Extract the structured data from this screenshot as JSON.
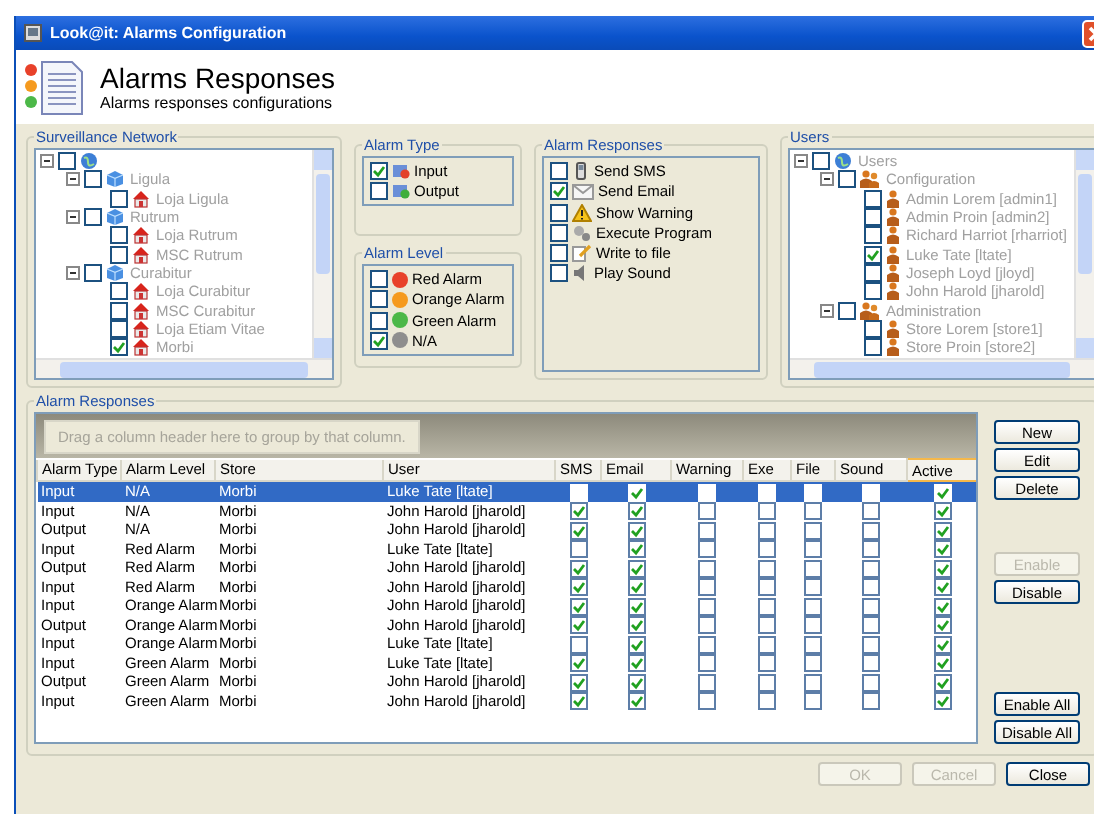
{
  "window": {
    "title": "Look@it: Alarms Configuration"
  },
  "header": {
    "title": "Alarms Responses",
    "subtitle": "Alarms responses configurations"
  },
  "surveillance_network": {
    "title": "Surveillance Network",
    "nodes": [
      {
        "kind": "globe",
        "checked": false,
        "expanded": true,
        "children": [
          {
            "label": "Ligula",
            "kind": "region",
            "checked": false,
            "expanded": true,
            "children": [
              {
                "label": "Loja Ligula",
                "kind": "store",
                "checked": false
              }
            ]
          },
          {
            "label": "Rutrum",
            "kind": "region",
            "checked": false,
            "expanded": true,
            "children": [
              {
                "label": "Loja Rutrum",
                "kind": "store",
                "checked": false
              },
              {
                "label": "MSC Rutrum",
                "kind": "store",
                "checked": false
              }
            ]
          },
          {
            "label": "Curabitur",
            "kind": "region",
            "checked": false,
            "expanded": true,
            "children": [
              {
                "label": "Loja Curabitur",
                "kind": "store",
                "checked": false
              },
              {
                "label": "MSC Curabitur",
                "kind": "store",
                "checked": false
              },
              {
                "label": "Loja Etiam Vitae",
                "kind": "store",
                "checked": false
              },
              {
                "label": "Morbi",
                "kind": "store",
                "checked": true
              }
            ]
          }
        ]
      }
    ]
  },
  "alarm_type": {
    "title": "Alarm Type",
    "items": [
      {
        "label": "Input",
        "checked": true,
        "kind": "input"
      },
      {
        "label": "Output",
        "checked": false,
        "kind": "output"
      }
    ]
  },
  "alarm_level": {
    "title": "Alarm Level",
    "items": [
      {
        "label": "Red Alarm",
        "checked": false,
        "color": "#e8412a"
      },
      {
        "label": "Orange Alarm",
        "checked": false,
        "color": "#f59a1e"
      },
      {
        "label": "Green Alarm",
        "checked": false,
        "color": "#4cb848"
      },
      {
        "label": "N/A",
        "checked": true,
        "color": "#8e8e8e"
      }
    ]
  },
  "alarm_responses_options": {
    "title": "Alarm Responses",
    "items": [
      {
        "label": "Send SMS",
        "checked": false,
        "kind": "sms"
      },
      {
        "label": "Send Email",
        "checked": true,
        "kind": "email"
      },
      {
        "label": "Show Warning",
        "checked": false,
        "kind": "warning"
      },
      {
        "label": "Execute Program",
        "checked": false,
        "kind": "program"
      },
      {
        "label": "Write to file",
        "checked": false,
        "kind": "file"
      },
      {
        "label": "Play Sound",
        "checked": false,
        "kind": "sound"
      }
    ]
  },
  "users": {
    "title": "Users",
    "nodes": [
      {
        "label": "Users",
        "kind": "globe",
        "checked": false,
        "expanded": true,
        "children": [
          {
            "label": "Configuration",
            "kind": "group",
            "checked": false,
            "expanded": true,
            "children": [
              {
                "label": "Admin Lorem [admin1]",
                "kind": "user",
                "checked": false
              },
              {
                "label": "Admin Proin [admin2]",
                "kind": "user",
                "checked": false
              },
              {
                "label": "Richard Harriot [rharriot]",
                "kind": "user",
                "checked": false
              },
              {
                "label": "Luke Tate [ltate]",
                "kind": "user",
                "checked": true
              },
              {
                "label": "Joseph Loyd [jloyd]",
                "kind": "user",
                "checked": false
              },
              {
                "label": "John Harold [jharold]",
                "kind": "user",
                "checked": false
              }
            ]
          },
          {
            "label": "Administration",
            "kind": "group",
            "checked": false,
            "expanded": true,
            "children": [
              {
                "label": "Store Lorem [store1]",
                "kind": "user",
                "checked": false
              },
              {
                "label": "Store Proin [store2]",
                "kind": "user",
                "checked": false
              }
            ]
          }
        ]
      }
    ]
  },
  "responses": {
    "title": "Alarm Responses",
    "group_hint": "Drag a column header here to group by that column.",
    "columns": [
      {
        "label": "Alarm Type",
        "kind": "text"
      },
      {
        "label": "Alarm Level",
        "kind": "text"
      },
      {
        "label": "Store",
        "kind": "text"
      },
      {
        "label": "User",
        "kind": "text"
      },
      {
        "label": "SMS",
        "kind": "check"
      },
      {
        "label": "Email",
        "kind": "check"
      },
      {
        "label": "Warning",
        "kind": "check"
      },
      {
        "label": "Exe",
        "kind": "check"
      },
      {
        "label": "File",
        "kind": "check"
      },
      {
        "label": "Sound",
        "kind": "check"
      },
      {
        "label": "Active",
        "kind": "check"
      }
    ],
    "rows": [
      {
        "selected": true,
        "values": [
          "Input",
          "N/A",
          "Morbi",
          "Luke Tate [ltate]",
          false,
          true,
          false,
          false,
          false,
          false,
          true
        ]
      },
      {
        "selected": false,
        "values": [
          "Input",
          "N/A",
          "Morbi",
          "John Harold [jharold]",
          true,
          true,
          false,
          false,
          false,
          false,
          true
        ]
      },
      {
        "selected": false,
        "values": [
          "Output",
          "N/A",
          "Morbi",
          "John Harold [jharold]",
          true,
          true,
          false,
          false,
          false,
          false,
          true
        ]
      },
      {
        "selected": false,
        "values": [
          "Input",
          "Red Alarm",
          "Morbi",
          "Luke Tate [ltate]",
          false,
          true,
          false,
          false,
          false,
          false,
          true
        ]
      },
      {
        "selected": false,
        "values": [
          "Output",
          "Red Alarm",
          "Morbi",
          "John Harold [jharold]",
          true,
          true,
          false,
          false,
          false,
          false,
          true
        ]
      },
      {
        "selected": false,
        "values": [
          "Input",
          "Red Alarm",
          "Morbi",
          "John Harold [jharold]",
          true,
          true,
          false,
          false,
          false,
          false,
          true
        ]
      },
      {
        "selected": false,
        "values": [
          "Input",
          "Orange Alarm",
          "Morbi",
          "John Harold [jharold]",
          true,
          true,
          false,
          false,
          false,
          false,
          true
        ]
      },
      {
        "selected": false,
        "values": [
          "Output",
          "Orange Alarm",
          "Morbi",
          "John Harold [jharold]",
          true,
          true,
          false,
          false,
          false,
          false,
          true
        ]
      },
      {
        "selected": false,
        "values": [
          "Input",
          "Orange Alarm",
          "Morbi",
          "Luke Tate [ltate]",
          false,
          true,
          false,
          false,
          false,
          false,
          true
        ]
      },
      {
        "selected": false,
        "values": [
          "Input",
          "Green Alarm",
          "Morbi",
          "Luke Tate [ltate]",
          true,
          true,
          false,
          false,
          false,
          false,
          true
        ]
      },
      {
        "selected": false,
        "values": [
          "Output",
          "Green Alarm",
          "Morbi",
          "John Harold [jharold]",
          true,
          true,
          false,
          false,
          false,
          false,
          true
        ]
      },
      {
        "selected": false,
        "values": [
          "Input",
          "Green Alarm",
          "Morbi",
          "John Harold [jharold]",
          true,
          true,
          false,
          false,
          false,
          false,
          true
        ]
      }
    ]
  },
  "side_buttons": [
    {
      "label": "New",
      "disabled": false,
      "kind": "top"
    },
    {
      "label": "Edit",
      "disabled": false,
      "kind": "top"
    },
    {
      "label": "Delete",
      "disabled": false,
      "kind": "top"
    },
    {
      "label": "Enable",
      "disabled": true,
      "kind": "middle"
    },
    {
      "label": "Disable",
      "disabled": false,
      "kind": "middle"
    },
    {
      "label": "Enable All",
      "disabled": false,
      "kind": "bottom"
    },
    {
      "label": "Disable All",
      "disabled": false,
      "kind": "bottom"
    }
  ],
  "footer_buttons": [
    {
      "label": "OK",
      "disabled": true
    },
    {
      "label": "Cancel",
      "disabled": true
    },
    {
      "label": "Close",
      "disabled": false
    }
  ]
}
